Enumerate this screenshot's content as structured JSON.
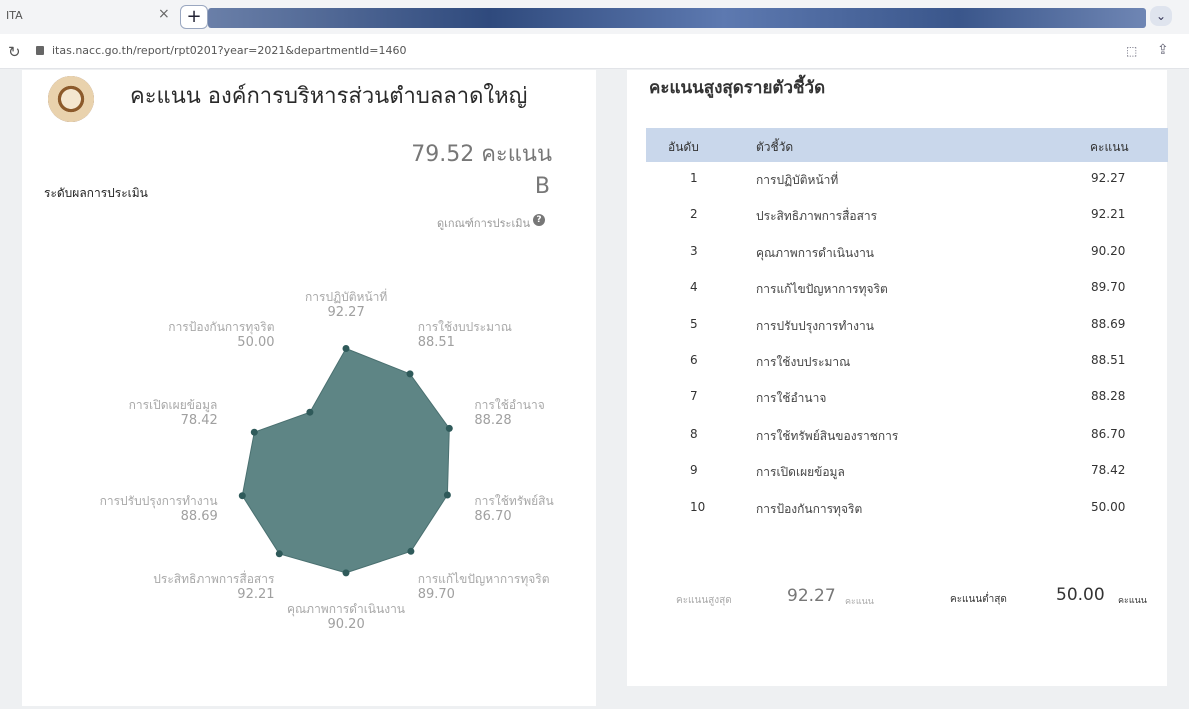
{
  "browser": {
    "tab_title": "ITA",
    "tab_close": "×",
    "tab_add": "+",
    "url": "itas.nacc.go.th/report/rpt0201?year=2021&departmentId=1460"
  },
  "left": {
    "org_title": "คะแนน องค์การบริหารส่วนตำบลลาดใหญ่",
    "score": "79.52 คะแนน",
    "level_label": "ระดับผลการประเมิน",
    "level_grade": "B",
    "criteria_link": "ดูเกณฑ์การประเมิน"
  },
  "chart_data": {
    "type": "radar",
    "categories": [
      "การปฏิบัติหน้าที่",
      "การใช้งบประมาณ",
      "การใช้อำนาจ",
      "การใช้ทรัพย์สิน",
      "การแก้ไขปัญหาการทุจริต",
      "คุณภาพการดำเนินงาน",
      "ประสิทธิภาพการสื่อสาร",
      "การปรับปรุงการทำงาน",
      "การเปิดเผยข้อมูล",
      "การป้องกันการทุจริต"
    ],
    "values": [
      92.27,
      88.51,
      88.28,
      86.7,
      89.7,
      90.2,
      92.21,
      88.69,
      78.42,
      50.0
    ],
    "value_labels": [
      "92.27",
      "88.51",
      "88.28",
      "86.70",
      "89.70",
      "90.20",
      "92.21",
      "88.69",
      "78.42",
      "50.00"
    ],
    "rlim": [
      0,
      100
    ],
    "fill_color": "#5e8585",
    "point_color": "#2f5a5a"
  },
  "right": {
    "title": "คะแนนสูงสุดรายตัวชี้วัด",
    "columns": [
      "อันดับ",
      "ตัวชี้วัด",
      "คะแนน"
    ],
    "rows": [
      {
        "rank": "1",
        "name": "การปฏิบัติหน้าที่",
        "score": "92.27"
      },
      {
        "rank": "2",
        "name": "ประสิทธิภาพการสื่อสาร",
        "score": "92.21"
      },
      {
        "rank": "3",
        "name": "คุณภาพการดำเนินงาน",
        "score": "90.20"
      },
      {
        "rank": "4",
        "name": "การแก้ไขปัญหาการทุจริต",
        "score": "89.70"
      },
      {
        "rank": "5",
        "name": "การปรับปรุงการทำงาน",
        "score": "88.69"
      },
      {
        "rank": "6",
        "name": "การใช้งบประมาณ",
        "score": "88.51"
      },
      {
        "rank": "7",
        "name": "การใช้อำนาจ",
        "score": "88.28"
      },
      {
        "rank": "8",
        "name": "การใช้ทรัพย์สินของราชการ",
        "score": "86.70"
      },
      {
        "rank": "9",
        "name": "การเปิดเผยข้อมูล",
        "score": "78.42"
      },
      {
        "rank": "10",
        "name": "การป้องกันการทุจริต",
        "score": "50.00"
      }
    ],
    "summary": {
      "max_label": "คะแนนสูงสุด",
      "max_value": "92.27",
      "max_unit": "คะแนน",
      "min_label": "คะแนนต่ำสุด",
      "min_value": "50.00",
      "min_unit": "คะแนน"
    }
  },
  "icons": {
    "reload": "reload-icon",
    "lock": "lock-icon",
    "translate": "translate-icon",
    "share": "share-icon",
    "help": "help-icon",
    "seal": "organization-seal-icon",
    "menu": "tab-menu-icon"
  }
}
